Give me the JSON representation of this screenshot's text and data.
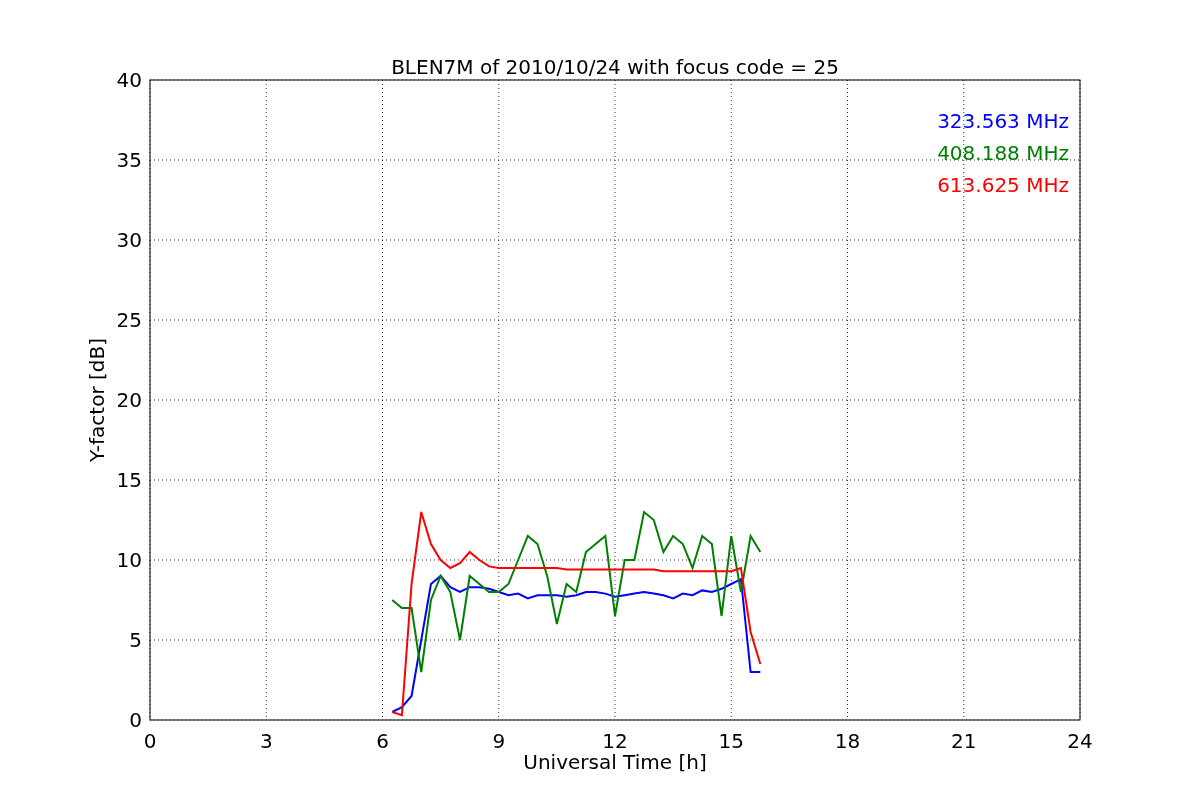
{
  "chart_data": {
    "type": "line",
    "title": "BLEN7M of 2010/10/24 with focus code = 25",
    "xlabel": "Universal Time [h]",
    "ylabel": "Y-factor [dB]",
    "x": [
      6.25,
      6.5,
      6.75,
      7,
      7.25,
      7.5,
      7.75,
      8,
      8.25,
      8.5,
      8.75,
      9,
      9.25,
      9.5,
      9.75,
      10,
      10.25,
      10.5,
      10.75,
      11,
      11.25,
      11.5,
      11.75,
      12,
      12.25,
      12.5,
      12.75,
      13,
      13.25,
      13.5,
      13.75,
      14,
      14.25,
      14.5,
      14.75,
      15,
      15.25,
      15.5,
      15.75
    ],
    "series": [
      {
        "name": "323.563 MHz",
        "color": "#0000ff",
        "values": [
          0.5,
          0.8,
          1.5,
          5,
          8.5,
          9,
          8.3,
          8,
          8.3,
          8.3,
          8.2,
          8,
          7.8,
          7.9,
          7.6,
          7.8,
          7.8,
          7.8,
          7.7,
          7.8,
          8,
          8,
          7.9,
          7.7,
          7.8,
          7.9,
          8,
          7.9,
          7.8,
          7.6,
          7.9,
          7.8,
          8.1,
          8,
          8.2,
          8.5,
          8.8,
          3,
          3
        ]
      },
      {
        "name": "408.188 MHz",
        "color": "#008000",
        "values": [
          7.5,
          7,
          7,
          3,
          7.5,
          9,
          8,
          5,
          9,
          8.5,
          8,
          8,
          8.5,
          10,
          11.5,
          11,
          9,
          6,
          8.5,
          8,
          10.5,
          11,
          11.5,
          6.5,
          10,
          10,
          13,
          12.5,
          10.5,
          11.5,
          11,
          9.5,
          11.5,
          11,
          6.5,
          11.5,
          8,
          11.5,
          10.5
        ]
      },
      {
        "name": "613.625 MHz",
        "color": "#ff0000",
        "values": [
          0.5,
          0.3,
          8.5,
          13,
          11,
          10,
          9.5,
          9.8,
          10.5,
          10,
          9.6,
          9.5,
          9.5,
          9.5,
          9.5,
          9.5,
          9.5,
          9.5,
          9.4,
          9.4,
          9.4,
          9.4,
          9.4,
          9.4,
          9.4,
          9.4,
          9.4,
          9.4,
          9.3,
          9.3,
          9.3,
          9.3,
          9.3,
          9.3,
          9.3,
          9.3,
          9.5,
          5.5,
          3.5
        ]
      }
    ],
    "xlim": [
      0,
      24
    ],
    "ylim": [
      0,
      40
    ],
    "xticks": [
      0,
      3,
      6,
      9,
      12,
      15,
      18,
      21,
      24
    ],
    "yticks": [
      0,
      5,
      10,
      15,
      20,
      25,
      30,
      35,
      40
    ],
    "grid": true
  }
}
